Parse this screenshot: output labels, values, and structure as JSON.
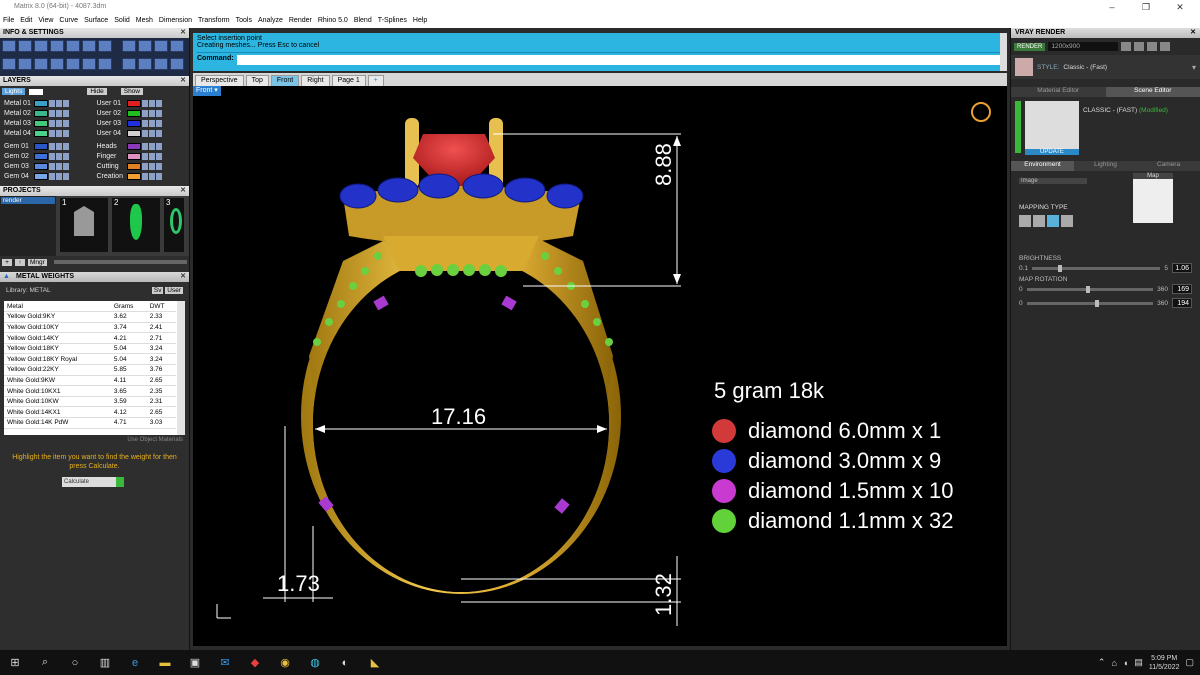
{
  "window": {
    "title": "Matrix 8.0 (64-bit) - 4087.3dm"
  },
  "menu": [
    "File",
    "Edit",
    "View",
    "Curve",
    "Surface",
    "Solid",
    "Mesh",
    "Dimension",
    "Transform",
    "Tools",
    "Analyze",
    "Render",
    "Rhino 5.0",
    "Blend",
    "T-Splines",
    "Help"
  ],
  "left": {
    "info_title": "INFO & SETTINGS",
    "layers_title": "LAYERS",
    "layers_filter": "Lights",
    "hide_label": "Hide",
    "show_label": "Show",
    "layers_left": [
      {
        "name": "Metal 01",
        "color": "#3aa0c8"
      },
      {
        "name": "Metal 02",
        "color": "#3ab88c"
      },
      {
        "name": "Metal 03",
        "color": "#46c87a"
      },
      {
        "name": "Metal 04",
        "color": "#4ad08a"
      },
      {
        "name": "Gem 01",
        "color": "#2a56c8"
      },
      {
        "name": "Gem 02",
        "color": "#3a70d8"
      },
      {
        "name": "Gem 03",
        "color": "#5a8ae0"
      },
      {
        "name": "Gem 04",
        "color": "#7aa4e8"
      }
    ],
    "layers_right": [
      {
        "name": "User 01",
        "color": "#e02020"
      },
      {
        "name": "User 02",
        "color": "#20c020"
      },
      {
        "name": "User 03",
        "color": "#2030e0"
      },
      {
        "name": "User 04",
        "color": "#d0d0d0"
      },
      {
        "name": "Heads",
        "color": "#8a3ab8"
      },
      {
        "name": "Finger",
        "color": "#e090c0"
      },
      {
        "name": "Cutting",
        "color": "#e08020"
      },
      {
        "name": "Creation",
        "color": "#f0a030"
      }
    ],
    "projects_title": "PROJECTS",
    "project_item": "render",
    "thumbs": [
      "1",
      "2",
      "3"
    ],
    "mngr_label": "Mngr",
    "weights_title": "METAL WEIGHTS",
    "library_label": "Library: METAL",
    "library_btns": [
      "Sv",
      "User"
    ],
    "table_headers": [
      "Metal",
      "Grams",
      "DWT"
    ],
    "table_rows": [
      [
        "Yellow Gold:9KY",
        "3.62",
        "2.33"
      ],
      [
        "Yellow Gold:10KY",
        "3.74",
        "2.41"
      ],
      [
        "Yellow Gold:14KY",
        "4.21",
        "2.71"
      ],
      [
        "Yellow Gold:18KY",
        "5.04",
        "3.24"
      ],
      [
        "Yellow Gold:18KY Royal",
        "5.04",
        "3.24"
      ],
      [
        "Yellow Gold:22KY",
        "5.85",
        "3.76"
      ],
      [
        "White Gold:9KW",
        "4.11",
        "2.65"
      ],
      [
        "White Gold:10KX1",
        "3.65",
        "2.35"
      ],
      [
        "White Gold:10KW",
        "3.59",
        "2.31"
      ],
      [
        "White Gold:14KX1",
        "4.12",
        "2.65"
      ],
      [
        "White Gold:14K PdW",
        "4.71",
        "3.03"
      ]
    ],
    "object_materials_label": "Use Object Materials",
    "hint": "Highlight the item you want to find the weight for then press Calculate.",
    "calculate_label": "Calculate"
  },
  "command": {
    "line1": "Select insertion point",
    "line2": "Creating meshes... Press Esc to cancel",
    "label": "Command:"
  },
  "tabs": [
    "Perspective",
    "Top",
    "Front",
    "Right",
    "Page 1"
  ],
  "view_label": "Front",
  "dims": {
    "height": "8.88",
    "width": "17.16",
    "shank": "1.73",
    "base": "1.32"
  },
  "legend": {
    "title": "5 gram 18k",
    "items": [
      {
        "label": "diamond 6.0mm x 1",
        "color": "#d23a3a"
      },
      {
        "label": "diamond 3.0mm x 9",
        "color": "#2a3ad8"
      },
      {
        "label": "diamond 1.5mm x 10",
        "color": "#c83ad0"
      },
      {
        "label": "diamond 1.1mm x 32",
        "color": "#62d23a"
      }
    ]
  },
  "right": {
    "title": "VRAY RENDER",
    "render_btn": "RENDER",
    "resolution": "1200x900",
    "style_label": "STYLE:",
    "style_value": "Classic - (Fast)",
    "tab_material": "Material Editor",
    "tab_scene": "Scene Editor",
    "preset_name": "CLASSIC - (FAST)",
    "preset_state": "(Modified)",
    "update_label": "UPDATE",
    "subtabs": [
      "Environment",
      "Lighting",
      "Camera"
    ],
    "env_type": "Image",
    "map_label": "Map",
    "mapping_type": "MAPPING TYPE",
    "brightness_label": "BRIGHTNESS",
    "brightness_min": "0.1",
    "brightness_max": "5",
    "brightness_value": "1.06",
    "brightness_level": 0.2,
    "rotation_label": "MAP ROTATION",
    "rot1_min": "0",
    "rot1_max": "360",
    "rot1_value": "169",
    "rot1_level": 0.47,
    "rot2_min": "0",
    "rot2_max": "360",
    "rot2_value": "194",
    "rot2_level": 0.54
  },
  "taskbar": {
    "time": "5:09 PM",
    "date": "11/5/2022"
  }
}
